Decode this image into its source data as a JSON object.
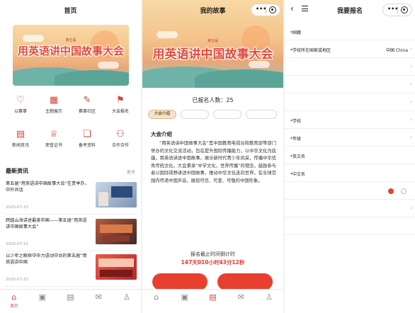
{
  "home": {
    "title": "首页",
    "banner": {
      "title": "用英语讲中国故事大会",
      "subtitle": "第五届"
    },
    "grid": [
      {
        "label": "以赛事",
        "icon": "heart-icon"
      },
      {
        "label": "主题展示",
        "icon": "grid-icon"
      },
      {
        "label": "赛事社区",
        "icon": "edit-icon"
      },
      {
        "label": "大会报名",
        "icon": "flag-icon"
      },
      {
        "label": "新闻资讯",
        "icon": "news-icon"
      },
      {
        "label": "荣誉证书",
        "icon": "trophy-icon"
      },
      {
        "label": "备考资料",
        "icon": "book-icon"
      },
      {
        "label": "合作合作",
        "icon": "org-icon"
      }
    ],
    "news_title": "最新资讯",
    "news_more": "更多",
    "news": [
      {
        "title": "第五届“用英语讲中国故事大会”在贵举办，中外共话",
        "date": "2025-07-31"
      },
      {
        "title": "跨越山海讲述最美中国——第五届“用英语讲中国故事大会”",
        "date": "2025-07-31"
      },
      {
        "title": "以少年之眼探中华力语动中台的第五届“用英语讲中国",
        "date": "2025-07-31"
      }
    ],
    "tabs": [
      {
        "label": "首页",
        "icon": "home-icon"
      },
      {
        "label": "",
        "icon": "calendar-icon"
      },
      {
        "label": "",
        "icon": "document-icon"
      },
      {
        "label": "",
        "icon": "certificate-icon"
      },
      {
        "label": "",
        "icon": "user-icon"
      }
    ]
  },
  "story": {
    "title": "我的故事",
    "count_label": "已报名人数：",
    "count": "25",
    "tabs": [
      "大会介绍",
      "",
      "",
      ""
    ],
    "intro_heading": "大会介绍",
    "intro": "“用英语讲中国故事大会”是中国教育电视台和教育部等部门举办的文化交流活动，旨在提升国际传播能力，以中华文化为底蕴，用英语讲述中国故事，展示新时代青少年风采，传播中华优秀传统文化。大会秉承“中学文化，世界传播”的理念，鼓励参与者以国际视野讲述中国故事，推动中华文化走向世界，在全球范围内传递中国声音，展现可信、可爱、可敬的中国形象。",
    "deadline_label": "报名截止时间倒计时",
    "deadline_value": "147天010小时43分12秒",
    "btn_cn": {
      "line1": "",
      "line2": ""
    },
    "btn_intl": {
      "line1": "",
      "line2": ""
    },
    "tabbar": [
      {
        "label": "",
        "icon": "home-icon"
      },
      {
        "label": "",
        "icon": "calendar-icon"
      },
      {
        "label": "",
        "icon": "document-icon"
      },
      {
        "label": "",
        "icon": "certificate-icon"
      },
      {
        "label": "",
        "icon": "user-icon"
      }
    ]
  },
  "signup": {
    "title": "我要报名",
    "fields": [
      {
        "label": "*国籍",
        "value": "",
        "chevron": false
      },
      {
        "label": "*学校所在国家或地区",
        "value": "中国 China",
        "chevron": true,
        "dark": true
      },
      {
        "label": "",
        "value": "",
        "chevron": true
      },
      {
        "label": "",
        "value": "",
        "chevron": true
      },
      {
        "label": "",
        "value": "",
        "chevron": true
      },
      {
        "label": "*学校",
        "value": "",
        "chevron": true
      },
      {
        "label": "*年级",
        "value": "",
        "chevron": true
      },
      {
        "label": "*英文名",
        "value": "",
        "chevron": false
      },
      {
        "label": "*中文名",
        "value": "",
        "chevron": false
      },
      {
        "label": "",
        "value": "",
        "chevron": false,
        "radio": true
      },
      {
        "label": "",
        "value": "",
        "chevron": true
      },
      {
        "label": "",
        "value": "",
        "chevron": false
      }
    ],
    "notice_heading": "",
    "notice_text": ""
  },
  "colors": {
    "brand": "#e8402f",
    "text": "#222222",
    "muted": "#999999"
  }
}
